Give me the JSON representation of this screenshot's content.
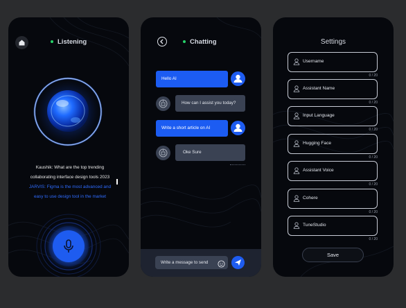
{
  "listening": {
    "title": "Listening",
    "user_line1": "Kaushik: What are the top trending",
    "user_line2": "collaborating interface design tools 2023",
    "ai_line1": "JARVIS: Figma is the most advanced and",
    "ai_line2": "easy to use design tool in the market"
  },
  "chatting": {
    "title": "Chatting",
    "messages": [
      {
        "from": "user",
        "text": "Hello AI"
      },
      {
        "from": "bot",
        "text": "How can I assist you today?"
      },
      {
        "from": "user",
        "text": "Write a short article on AI"
      },
      {
        "from": "bot",
        "text": "Oke Sure"
      }
    ],
    "input_placeholder": "Write a message to send"
  },
  "settings": {
    "title": "Settings",
    "fields": [
      {
        "label": "Username",
        "counter": "0 / 20"
      },
      {
        "label": "Assistant Name",
        "counter": "0 / 20"
      },
      {
        "label": "Input Language",
        "counter": "0 / 20"
      },
      {
        "label": "Hugging Face",
        "counter": "0 / 20"
      },
      {
        "label": "Assistant Voice",
        "counter": "0 / 20"
      },
      {
        "label": "Cohere",
        "counter": "0 / 20"
      },
      {
        "label": "TuneStudio",
        "counter": "0 / 20"
      }
    ],
    "save_label": "Save"
  },
  "colors": {
    "background": "#2b2c2e",
    "phone": "#06080d",
    "accent_blue": "#1e5cf0",
    "ai_text": "#2f6cff",
    "status_green": "#27d36a",
    "bot_bubble": "#3a4253"
  },
  "icons": [
    "home-icon",
    "back-arrow-icon",
    "mic-icon",
    "user-avatar-icon",
    "bot-avatar-icon",
    "emoji-icon",
    "send-icon",
    "user-outline-icon"
  ]
}
